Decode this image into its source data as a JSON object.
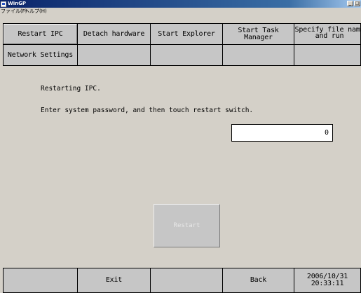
{
  "window": {
    "title": "WinGP"
  },
  "menu": {
    "file": "ファイル(F)",
    "help": "ヘルプ(H)"
  },
  "controls": {
    "minimize": "_",
    "restore": "□"
  },
  "tabs_row1": [
    "Restart IPC",
    "Detach hardware",
    "Start Explorer",
    "Start Task Manager",
    "Specify file name and run"
  ],
  "tabs_row2": [
    "Network Settings",
    "",
    "",
    "",
    ""
  ],
  "active_tab": "Restart IPC",
  "content": {
    "line1": "Restarting IPC.",
    "line2": "Enter system password, and then touch restart switch.",
    "password_value": "0",
    "restart_label": "Restart"
  },
  "footer": {
    "buttons": [
      "",
      "Exit",
      "",
      "Back"
    ],
    "date": "2006/10/31",
    "time": "20:33:11"
  }
}
